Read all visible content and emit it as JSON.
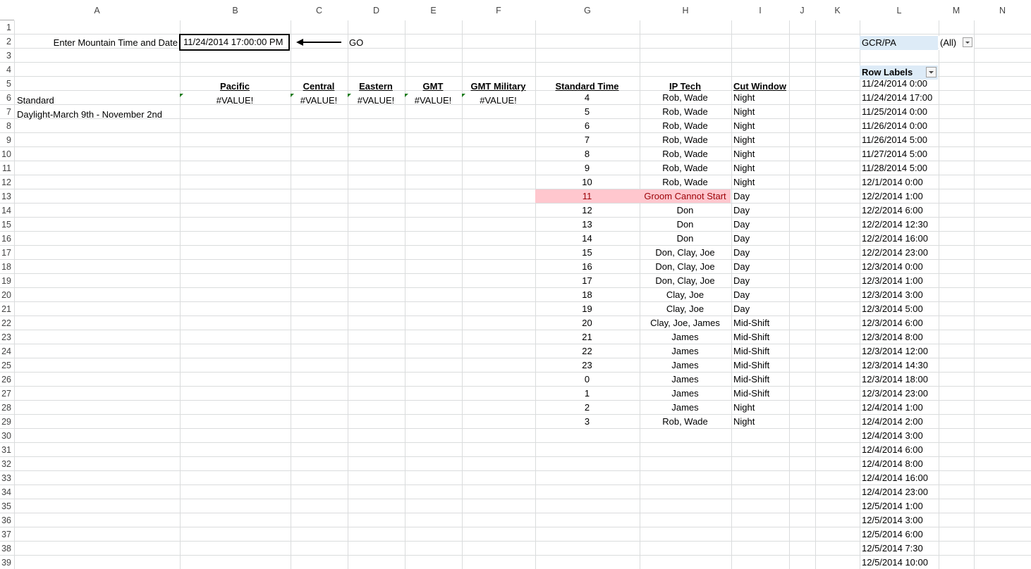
{
  "columns": [
    "A",
    "B",
    "C",
    "D",
    "E",
    "F",
    "G",
    "H",
    "I",
    "J",
    "K",
    "L",
    "M",
    "N"
  ],
  "row_numbers": [
    "1",
    "2",
    "3",
    "4",
    "5",
    "6",
    "7",
    "8",
    "9",
    "10",
    "11",
    "12",
    "13",
    "14",
    "15",
    "16",
    "17",
    "18",
    "19",
    "20",
    "21",
    "22",
    "23",
    "24",
    "25",
    "26",
    "27",
    "28",
    "29",
    "30",
    "31",
    "32",
    "33",
    "34",
    "35",
    "36",
    "37",
    "38",
    "39"
  ],
  "input": {
    "label": "Enter Mountain Time and Date",
    "value": "11/24/2014  17:00:00 PM",
    "arrow": "←",
    "go": "GO"
  },
  "zones": {
    "headers": [
      "Pacific",
      "Central",
      "Eastern",
      "GMT",
      "GMT Military"
    ],
    "row6_label": "Standard",
    "row7_label": "Daylight-March 9th - November 2nd",
    "row6_values": [
      "#VALUE!",
      "#VALUE!",
      "#VALUE!",
      "#VALUE!",
      "#VALUE!"
    ]
  },
  "schedule": {
    "headers": [
      "Standard Time",
      "IP Tech",
      "Cut Window"
    ],
    "rows": [
      [
        "4",
        "Rob, Wade",
        "Night"
      ],
      [
        "5",
        "Rob, Wade",
        "Night"
      ],
      [
        "6",
        "Rob, Wade",
        "Night"
      ],
      [
        "7",
        "Rob, Wade",
        "Night"
      ],
      [
        "8",
        "Rob, Wade",
        "Night"
      ],
      [
        "9",
        "Rob, Wade",
        "Night"
      ],
      [
        "10",
        "Rob, Wade",
        "Night"
      ],
      [
        "11",
        "Groom Cannot Start",
        "Day"
      ],
      [
        "12",
        "Don",
        "Day"
      ],
      [
        "13",
        "Don",
        "Day"
      ],
      [
        "14",
        "Don",
        "Day"
      ],
      [
        "15",
        "Don, Clay, Joe",
        "Day"
      ],
      [
        "16",
        "Don, Clay, Joe",
        "Day"
      ],
      [
        "17",
        "Don, Clay, Joe",
        "Day"
      ],
      [
        "18",
        "Clay, Joe",
        "Day"
      ],
      [
        "19",
        "Clay, Joe",
        "Day"
      ],
      [
        "20",
        "Clay, Joe, James",
        "Mid-Shift"
      ],
      [
        "21",
        "James",
        "Mid-Shift"
      ],
      [
        "22",
        "James",
        "Mid-Shift"
      ],
      [
        "23",
        "James",
        "Mid-Shift"
      ],
      [
        "0",
        "James",
        "Mid-Shift"
      ],
      [
        "1",
        "James",
        "Mid-Shift"
      ],
      [
        "2",
        "James",
        "Night"
      ],
      [
        "3",
        "Rob, Wade",
        "Night"
      ]
    ],
    "highlight_row": 7,
    "highlight_bg": "#ffc7ce",
    "highlight_fg": "#9c0006"
  },
  "pivot": {
    "filter_label": "GCR/PA",
    "filter_value": "(All)",
    "row_labels": "Row Labels",
    "header_bg": "#ddebf7",
    "items": [
      "11/24/2014 0:00",
      "11/24/2014 17:00",
      "11/25/2014 0:00",
      "11/26/2014 0:00",
      "11/26/2014 5:00",
      "11/27/2014 5:00",
      "11/28/2014 5:00",
      "12/1/2014 0:00",
      "12/2/2014 1:00",
      "12/2/2014 6:00",
      "12/2/2014 12:30",
      "12/2/2014 16:00",
      "12/2/2014 23:00",
      "12/3/2014 0:00",
      "12/3/2014 1:00",
      "12/3/2014 3:00",
      "12/3/2014 5:00",
      "12/3/2014 6:00",
      "12/3/2014 8:00",
      "12/3/2014 12:00",
      "12/3/2014 14:30",
      "12/3/2014 18:00",
      "12/3/2014 23:00",
      "12/4/2014 1:00",
      "12/4/2014 2:00",
      "12/4/2014 3:00",
      "12/4/2014 6:00",
      "12/4/2014 8:00",
      "12/4/2014 16:00",
      "12/4/2014 23:00",
      "12/5/2014 1:00",
      "12/5/2014 3:00",
      "12/5/2014 6:00",
      "12/5/2014 7:30",
      "12/5/2014 10:00"
    ]
  }
}
